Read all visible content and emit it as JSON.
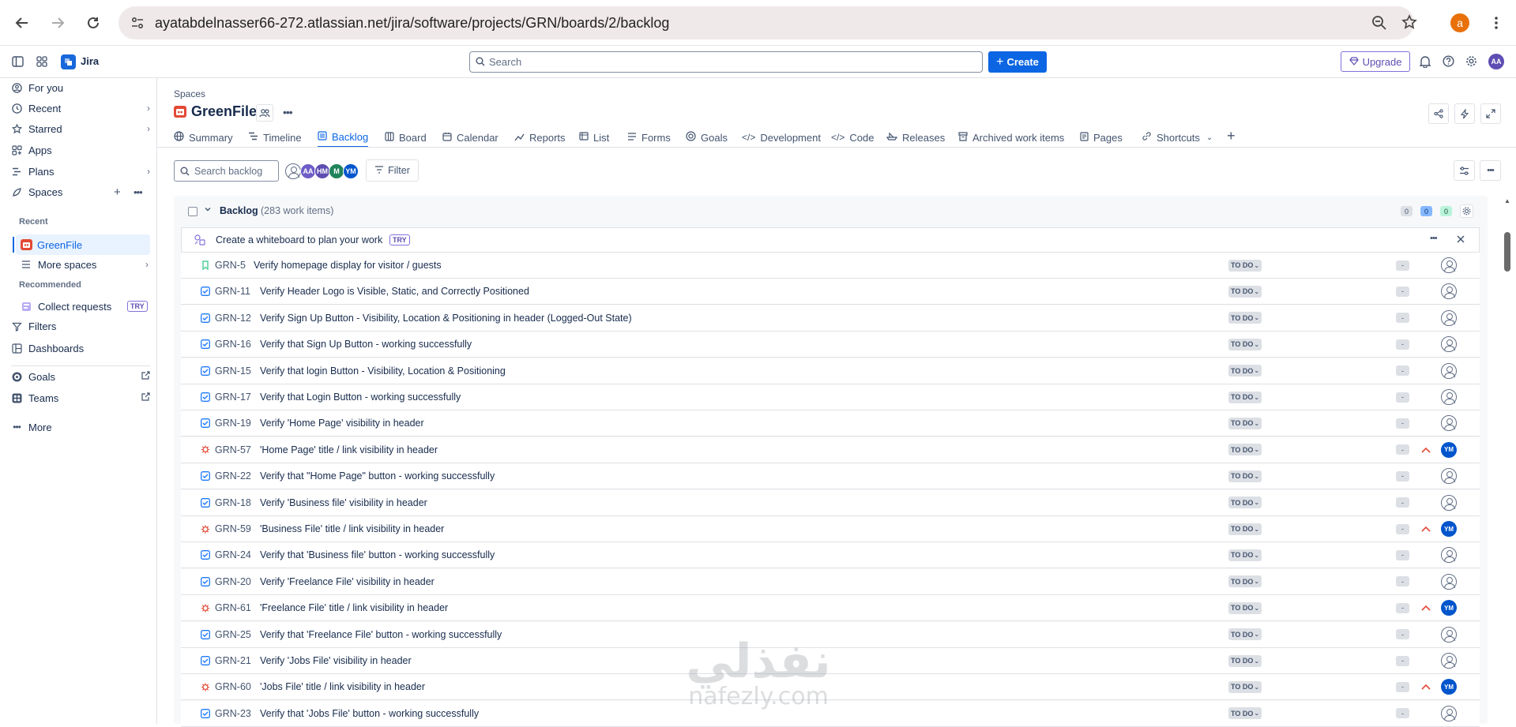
{
  "browser": {
    "url": "ayatabdelnasser66-272.atlassian.net/jira/software/projects/GRN/boards/2/backlog",
    "profile_initial": "a"
  },
  "topnav": {
    "app_name": "Jira",
    "search_placeholder": "Search",
    "create_label": "Create",
    "upgrade_label": "Upgrade",
    "user_initials": "AA"
  },
  "sidebar": {
    "for_you": "For you",
    "recent": "Recent",
    "starred": "Starred",
    "apps": "Apps",
    "plans": "Plans",
    "spaces": "Spaces",
    "recent_header": "Recent",
    "greenfile": "GreenFile",
    "more_spaces": "More spaces",
    "recommended_header": "Recommended",
    "collect_requests": "Collect requests",
    "try_badge": "TRY",
    "filters": "Filters",
    "dashboards": "Dashboards",
    "goals": "Goals",
    "teams": "Teams",
    "more": "More"
  },
  "project": {
    "breadcrumb": "Spaces",
    "name": "GreenFile"
  },
  "tabs": [
    "Summary",
    "Timeline",
    "Backlog",
    "Board",
    "Calendar",
    "Reports",
    "List",
    "Forms",
    "Goals",
    "Development",
    "Code",
    "Releases",
    "Archived work items",
    "Pages",
    "Shortcuts"
  ],
  "toolbar": {
    "search_placeholder": "Search backlog",
    "filter_label": "Filter",
    "avatars": [
      "AA",
      "HM",
      "M",
      "YM"
    ]
  },
  "backlog": {
    "title": "Backlog",
    "count": "(283 work items)",
    "badge_todo": "0",
    "badge_progress": "0",
    "badge_done": "0",
    "whiteboard_text": "Create a whiteboard to plan your work",
    "whiteboard_try": "TRY"
  },
  "items": [
    {
      "type": "story",
      "key": "GRN-5",
      "summary": "Verify homepage display for visitor / guests",
      "status": "TO DO",
      "estimate": "-",
      "assignee": ""
    },
    {
      "type": "task",
      "key": "GRN-11",
      "summary": "Verify Header Logo is Visible, Static, and Correctly Positioned",
      "status": "TO DO",
      "estimate": "-",
      "assignee": ""
    },
    {
      "type": "task",
      "key": "GRN-12",
      "summary": "Verify Sign Up Button - Visibility, Location & Positioning in header (Logged-Out State)",
      "status": "TO DO",
      "estimate": "-",
      "assignee": ""
    },
    {
      "type": "task",
      "key": "GRN-16",
      "summary": "Verify that Sign Up Button - working successfully",
      "status": "TO DO",
      "estimate": "-",
      "assignee": ""
    },
    {
      "type": "task",
      "key": "GRN-15",
      "summary": "Verify that login Button - Visibility, Location & Positioning",
      "status": "TO DO",
      "estimate": "-",
      "assignee": ""
    },
    {
      "type": "task",
      "key": "GRN-17",
      "summary": "Verify that Login Button - working successfully",
      "status": "TO DO",
      "estimate": "-",
      "assignee": ""
    },
    {
      "type": "task",
      "key": "GRN-19",
      "summary": "Verify 'Home Page' visibility in header",
      "status": "TO DO",
      "estimate": "-",
      "assignee": ""
    },
    {
      "type": "bug",
      "key": "GRN-57",
      "summary": "'Home Page' title / link visibility in header",
      "status": "TO DO",
      "estimate": "-",
      "assignee": "YM"
    },
    {
      "type": "task",
      "key": "GRN-22",
      "summary": "Verify that \"Home Page\" button - working successfully",
      "status": "TO DO",
      "estimate": "-",
      "assignee": ""
    },
    {
      "type": "task",
      "key": "GRN-18",
      "summary": "Verify 'Business file' visibility in header",
      "status": "TO DO",
      "estimate": "-",
      "assignee": ""
    },
    {
      "type": "bug",
      "key": "GRN-59",
      "summary": "'Business File' title / link visibility in header",
      "status": "TO DO",
      "estimate": "-",
      "assignee": "YM"
    },
    {
      "type": "task",
      "key": "GRN-24",
      "summary": "Verify that 'Business file' button - working successfully",
      "status": "TO DO",
      "estimate": "-",
      "assignee": ""
    },
    {
      "type": "task",
      "key": "GRN-20",
      "summary": "Verify 'Freelance File' visibility in header",
      "status": "TO DO",
      "estimate": "-",
      "assignee": ""
    },
    {
      "type": "bug",
      "key": "GRN-61",
      "summary": "'Freelance File' title / link visibility in header",
      "status": "TO DO",
      "estimate": "-",
      "assignee": "YM"
    },
    {
      "type": "task",
      "key": "GRN-25",
      "summary": "Verify that 'Freelance File' button - working successfully",
      "status": "TO DO",
      "estimate": "-",
      "assignee": ""
    },
    {
      "type": "task",
      "key": "GRN-21",
      "summary": "Verify 'Jobs File' visibility in header",
      "status": "TO DO",
      "estimate": "-",
      "assignee": ""
    },
    {
      "type": "bug",
      "key": "GRN-60",
      "summary": "'Jobs File' title / link visibility in header",
      "status": "TO DO",
      "estimate": "-",
      "assignee": "YM"
    },
    {
      "type": "task",
      "key": "GRN-23",
      "summary": "Verify that 'Jobs File' button - working successfully",
      "status": "TO DO",
      "estimate": "-",
      "assignee": ""
    }
  ],
  "watermark": {
    "arabic": "نفذلي",
    "latin": "nafezly.com"
  }
}
